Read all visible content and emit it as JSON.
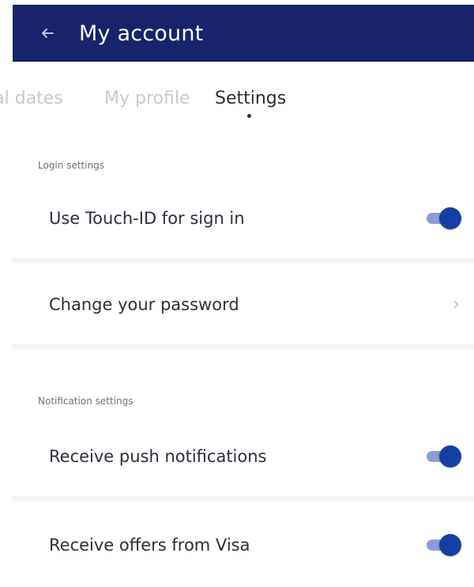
{
  "header": {
    "title": "My account",
    "back_icon": "back-arrow-icon"
  },
  "tabs": [
    {
      "label": "ial dates",
      "active": false
    },
    {
      "label": "My profile",
      "active": false
    },
    {
      "label": "Settings",
      "active": true
    }
  ],
  "sections": {
    "login": {
      "label": "Login settings",
      "items": [
        {
          "label": "Use Touch-ID for sign in",
          "control": "toggle",
          "on": true
        },
        {
          "label": "Change your password",
          "control": "chevron",
          "icon": "chevron-right-icon"
        }
      ]
    },
    "notifications": {
      "label": "Notification settings",
      "items": [
        {
          "label": "Receive push notifications",
          "control": "toggle",
          "on": true
        },
        {
          "label": "Receive offers from Visa",
          "control": "toggle",
          "on": true
        }
      ]
    }
  },
  "colors": {
    "app_bar": "#19236b",
    "toggle_on": "#163fa6",
    "toggle_track": "#8a9dd6"
  }
}
